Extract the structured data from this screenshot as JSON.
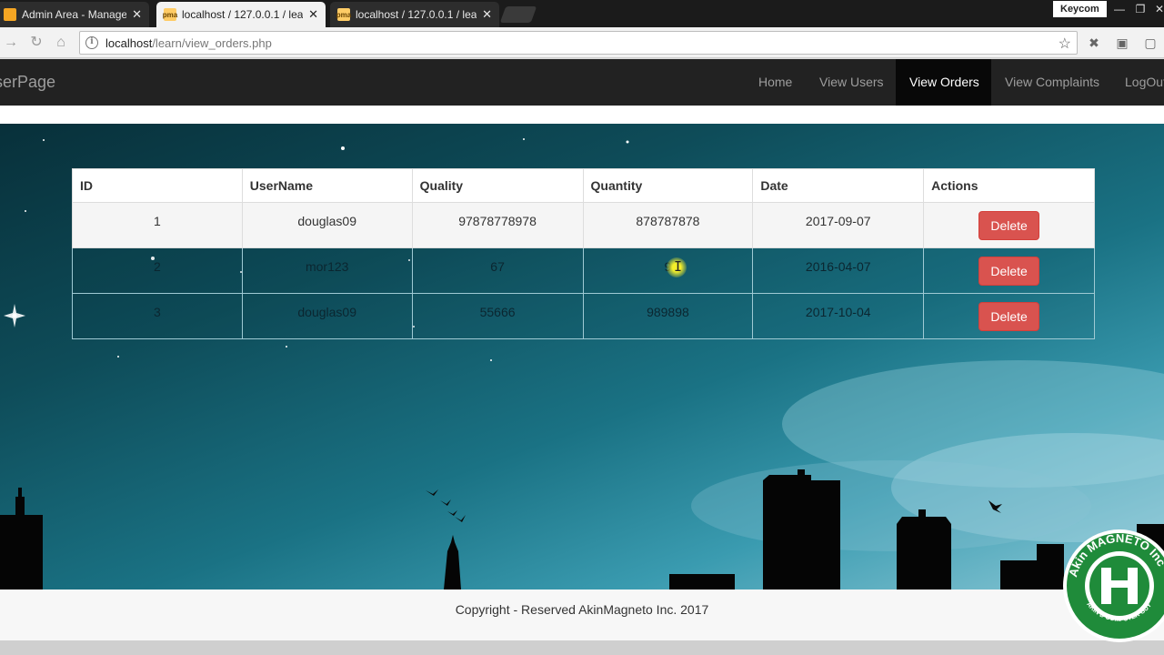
{
  "browser": {
    "tabs": [
      {
        "title": "Admin Area - Manage Ak",
        "active": false
      },
      {
        "title": "localhost / 127.0.0.1 / lea",
        "active": true
      },
      {
        "title": "localhost / 127.0.0.1 / lea",
        "active": false
      }
    ],
    "favicon_text": "pma",
    "profile": "Keycom",
    "url_host": "localhost",
    "url_path": "/learn/view_orders.php",
    "close_glyph": "✕",
    "win_min": "—",
    "win_max": "❐",
    "win_close": "✕"
  },
  "navbar": {
    "brand": "serPage",
    "links": [
      "Home",
      "View Users",
      "View Orders",
      "View Complaints",
      "LogOut"
    ],
    "active": "View Orders"
  },
  "orders": {
    "headers": [
      "ID",
      "UserName",
      "Quality",
      "Quantity",
      "Date",
      "Actions"
    ],
    "rows": [
      {
        "id": "1",
        "username": "douglas09",
        "quality": "97878778978",
        "quantity": "878787878",
        "date": "2017-09-07",
        "action": "Delete"
      },
      {
        "id": "2",
        "username": "mor123",
        "quality": "67",
        "quantity": "9",
        "date": "2016-04-07",
        "action": "Delete"
      },
      {
        "id": "3",
        "username": "douglas09",
        "quality": "55666",
        "quantity": "989898",
        "date": "2017-10-04",
        "action": "Delete"
      }
    ]
  },
  "footer": {
    "text": "Copyright - Reserved AkinMagneto Inc. 2017"
  },
  "cursor_glyph": "I",
  "badge": {
    "text": "Akin MAGNETO Inc",
    "subtext": "AKIN D COMPUTER GUY"
  },
  "colors": {
    "navbar": "#222222",
    "active_nav": "#080808",
    "delete": "#d9534f",
    "badge_green": "#1f8b3a"
  }
}
